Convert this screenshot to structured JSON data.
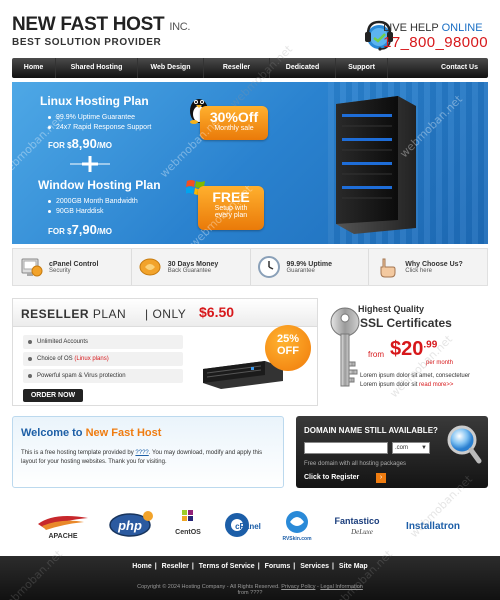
{
  "header": {
    "logo_main": "NEW FAST HOST",
    "logo_inc": "INC.",
    "logo_sub": "BEST SOLUTION PROVIDER",
    "live_help": "LIVE HELP",
    "online": "ONLINE",
    "phone": "17_800_98000"
  },
  "nav": {
    "items": [
      {
        "label": "Home"
      },
      {
        "label": "Shared Hosting"
      },
      {
        "label": "Web Design"
      },
      {
        "label": "Reseller"
      },
      {
        "label": "Dedicated"
      },
      {
        "label": "Support"
      },
      {
        "label": "Contact Us"
      }
    ]
  },
  "banner": {
    "linux": {
      "title": "Linux Hosting Plan",
      "bullets": [
        "99.9% Uptime Guarantee",
        "24x7 Rapid Response Support"
      ],
      "price_prefix": "FOR $",
      "price": "8,90",
      "price_suffix": "/MO"
    },
    "windows": {
      "title": "Window Hosting Plan",
      "bullets": [
        "2000GB Month Bandwidth",
        "90GB Harddisk"
      ],
      "price_prefix": "FOR $",
      "price": "7,90",
      "price_suffix": "/MO"
    },
    "badge_sale": {
      "big": "30%Off",
      "small": "Monthly sale"
    },
    "badge_free": {
      "big": "FREE",
      "small1": "Setup with",
      "small2": "every plan"
    }
  },
  "features": [
    {
      "title": "cPanel Control",
      "sub": "Security",
      "icon": "cpanel-icon"
    },
    {
      "title": "30 Days Money",
      "sub": "Back Guarantee",
      "icon": "money-icon"
    },
    {
      "title": "99.9% Uptime",
      "sub": "Guarantee",
      "icon": "clock-icon"
    },
    {
      "title": "Why Choose Us?",
      "sub": "Click here",
      "icon": "pointer-hand-icon"
    }
  ],
  "reseller": {
    "title_bold": "RESELLER",
    "title_plan": "PLAN",
    "only": "| ONLY",
    "price": "$6.50",
    "items": [
      {
        "text": "Unlimited Accounts",
        "extra": ""
      },
      {
        "text": "Choice of OS ",
        "extra": "(Linux plans)"
      },
      {
        "text": "Powerful spam & Virus protection",
        "extra": ""
      }
    ],
    "order": "ORDER NOW",
    "discount_1": "25%",
    "discount_2": "OFF"
  },
  "ssl": {
    "t1_a": "Highest ",
    "t1_b": "Quality",
    "t2": "SSL Certificates",
    "from": "from",
    "price_int": "$20",
    "price_dec": ".99",
    "per": "per month",
    "lorem1": "Lorem ipsum dolor sit amet, consectetuer",
    "lorem2": "Lorem ipsum dolor sit",
    "more": "read more>>"
  },
  "welcome": {
    "title_a": "Welcome to ",
    "title_b": "New Fast Host",
    "text_a": "This is a free hosting template provided by ",
    "link": "????",
    "text_b": ". You may download, modify and apply this layout for your hosting websites. Thank you for visiting."
  },
  "domain": {
    "title": "DOMAIN NAME STILL AVAILABLE?",
    "input_placeholder": "",
    "select_value": ".com",
    "note": "Free domain with all hosting packages",
    "register": "Click to Register"
  },
  "partners": [
    {
      "label": "APACHE",
      "icon": "apache-logo-icon"
    },
    {
      "label": "php",
      "icon": "php-logo-icon"
    },
    {
      "label": "CentOS",
      "icon": "centos-logo-icon"
    },
    {
      "label": "cPanel",
      "icon": "cpanel-logo-icon"
    },
    {
      "label": "RVSkin.com",
      "icon": "rvskin-logo-icon"
    },
    {
      "label": "Fantastico",
      "sub": "DeLuxe",
      "icon": "fantastico-logo-icon"
    },
    {
      "label": "Installatron",
      "icon": "installatron-logo-icon"
    }
  ],
  "footer": {
    "links": [
      "Home",
      "Reseller",
      "Terms of Service",
      "Forums",
      "Services",
      "Site Map"
    ],
    "copyright_a": "Copyright © 2024 Hosting Company - All Rights Reserved. ",
    "privacy": "Privacy Policy",
    "sep": " - ",
    "legal": "Legal Information",
    "from": "from ????"
  },
  "watermark": "webmoban.net"
}
